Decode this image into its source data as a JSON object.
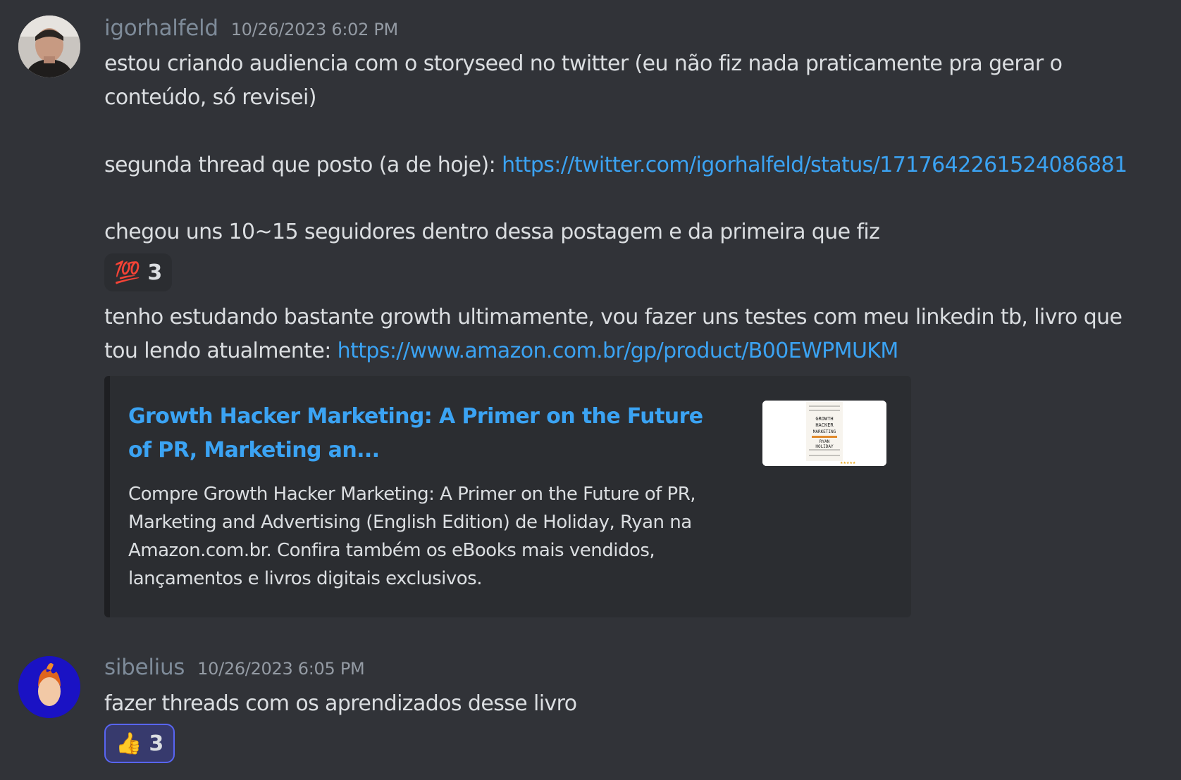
{
  "messages": [
    {
      "username": "igorhalfeld",
      "username_color": "#7e8b99",
      "timestamp": "10/26/2023 6:02 PM",
      "line1": "estou criando audiencia com o storyseed no twitter (eu não fiz nada praticamente pra gerar o",
      "line2": "conteúdo, só revisei)",
      "line3_prefix": "segunda thread que posto (a de hoje): ",
      "line3_link": "https://twitter.com/igorhalfeld/status/1717642261524086881",
      "line4": "chegou uns 10~15 seguidores dentro dessa postagem e da primeira que fiz",
      "reaction": {
        "emoji": "💯",
        "count": "3"
      },
      "line5": "tenho estudando bastante growth ultimamente, vou fazer uns testes com meu linkedin tb, livro que",
      "line6_prefix": "tou lendo atualmente: ",
      "line6_link": "https://www.amazon.com.br/gp/product/B00EWPMUKM",
      "embed": {
        "title": "Growth Hacker Marketing: A Primer on the Future of PR, Marketing an...",
        "description": "Compre Growth Hacker Marketing: A Primer on the Future of PR, Marketing and Advertising (English Edition) de Holiday, Ryan na Amazon.com.br. Confira também os eBooks mais vendidos, lançamentos e livros digitais exclusivos.",
        "thumbnail_text": "GROWTH HACKER MARKETING RYAN HOLIDAY"
      }
    },
    {
      "username": "sibelius",
      "username_color": "#7e8b99",
      "timestamp": "10/26/2023 6:05 PM",
      "line1": "fazer threads com os aprendizados desse livro",
      "reaction": {
        "emoji": "👍",
        "count": "3"
      }
    }
  ],
  "colors": {
    "background": "#313338",
    "text": "#dbdee1",
    "link": "#3ba3f3",
    "timestamp": "#949ba4",
    "embed_background": "#2b2d31",
    "reaction_active_border": "#5865f2"
  }
}
